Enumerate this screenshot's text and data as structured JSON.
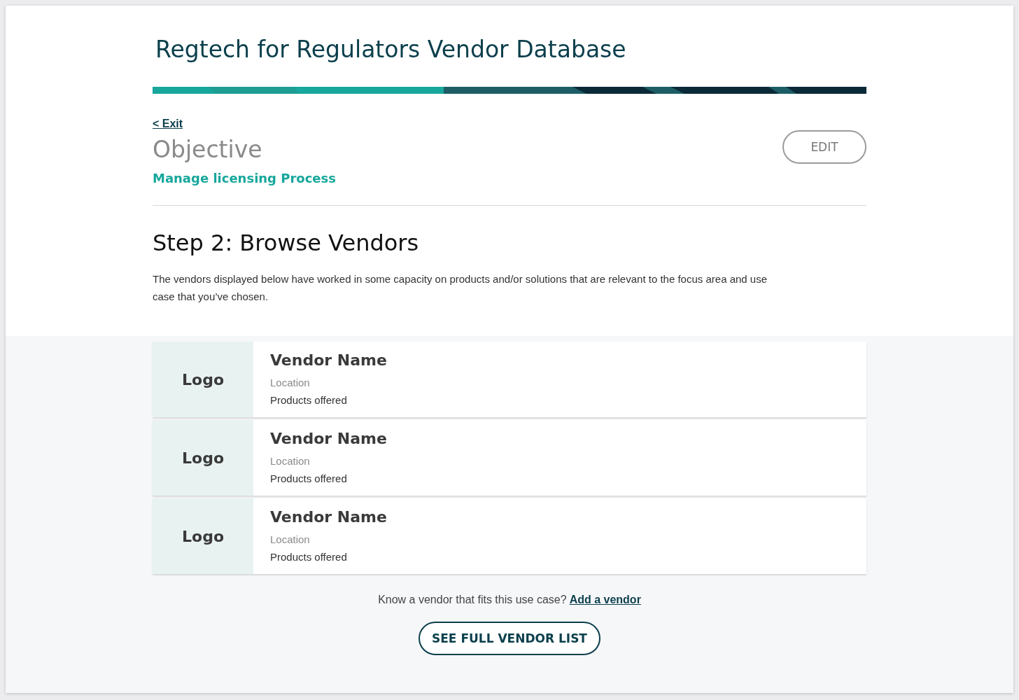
{
  "header": {
    "title": "Regtech for Regulators Vendor Database"
  },
  "nav": {
    "exit_link": "< Exit"
  },
  "objective": {
    "heading": "Objective",
    "value": "Manage licensing Process",
    "edit_button": "EDIT"
  },
  "step": {
    "heading": "Step 2: Browse Vendors",
    "description": "The vendors displayed below have worked in some capacity on products and/or solutions that are relevant to the focus area and use case that you’ve chosen."
  },
  "vendors": [
    {
      "logo": "Logo",
      "name": "Vendor Name",
      "location": "Location",
      "products": "Products offered"
    },
    {
      "logo": "Logo",
      "name": "Vendor Name",
      "location": "Location",
      "products": "Products offered"
    },
    {
      "logo": "Logo",
      "name": "Vendor Name",
      "location": "Location",
      "products": "Products offered"
    }
  ],
  "footer": {
    "prompt": "Know a vendor that fits this use case?",
    "link": "Add a vendor",
    "button": "SEE FULL VENDOR LIST"
  }
}
